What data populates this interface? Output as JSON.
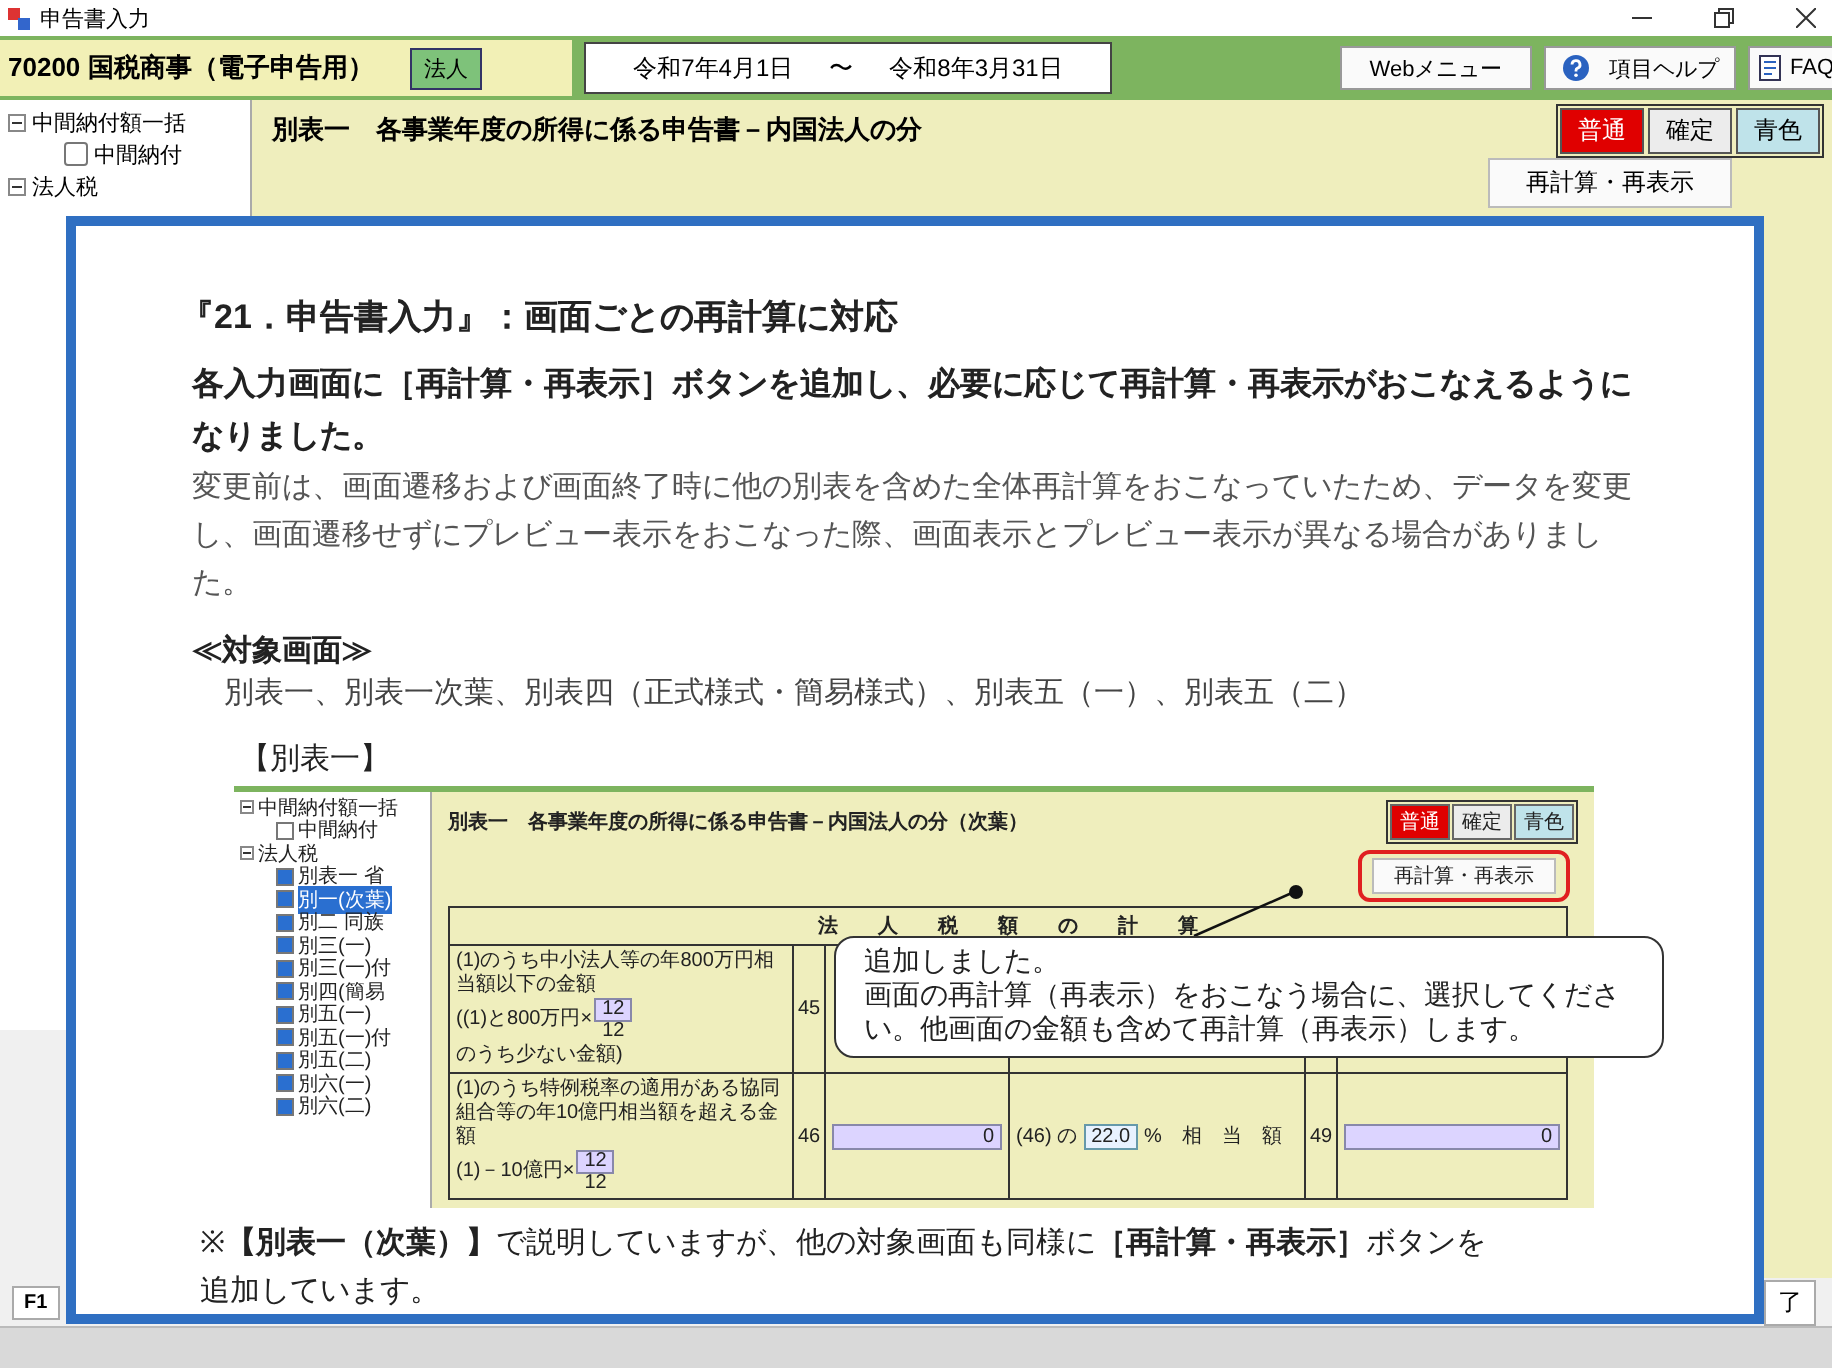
{
  "window": {
    "title": "申告書入力"
  },
  "header": {
    "company": "70200 国税商事（電子申告用）",
    "entity": "法人",
    "period_start": "令和7年4月1日",
    "period_sep": "〜",
    "period_end": "令和8年3月31日",
    "buttons": [
      {
        "label": "Webメニュー",
        "kind": "plain"
      },
      {
        "label": "項目ヘルプ",
        "kind": "help"
      },
      {
        "label": "FAQ",
        "kind": "faq"
      }
    ]
  },
  "tree": [
    {
      "label": "中間納付額一括",
      "expanded": true,
      "children": [
        {
          "label": "中間納付",
          "checked": false
        }
      ]
    },
    {
      "label": "法人税",
      "expanded": true
    }
  ],
  "form": {
    "title": "別表一　各事業年度の所得に係る申告書－内国法人の分",
    "modes": [
      {
        "label": "普通",
        "selected": true
      },
      {
        "label": "確定",
        "selected": false,
        "color": "#ececec"
      },
      {
        "label": "青色",
        "selected": false,
        "color": "#bfe3ea"
      }
    ],
    "recalc_button": "再計算・再表示"
  },
  "notice": {
    "heading": "『21．申告書入力』：画面ごとの再計算に対応",
    "lead": "各入力画面に［再計算・再表示］ボタンを追加し、必要に応じて再計算・再表示がおこなえるようになりました。",
    "body": "変更前は、画面遷移および画面終了時に他の別表を含めた全体再計算をおこなっていたため、データを変更し、画面遷移せずにプレビュー表示をおこなった際、画面表示とプレビュー表示が異なる場合がありました。",
    "section_title": "≪対象画面≫",
    "targets": "別表一、別表一次葉、別表四（正式様式・簡易様式）、別表五（一）、別表五（二）",
    "figure_label": "【別表一】",
    "figure": {
      "tree": [
        {
          "label": "中間納付額一括",
          "children": [
            {
              "label": "中間納付",
              "checked": false,
              "selected": false
            }
          ]
        },
        {
          "label": "法人税",
          "children": [
            {
              "label": "別表一 省",
              "checked": true,
              "selected": false
            },
            {
              "label": "別一(次葉)",
              "checked": true,
              "selected": true
            },
            {
              "label": "別二 同族",
              "checked": true,
              "selected": false
            },
            {
              "label": "別三(一)",
              "checked": true,
              "selected": false
            },
            {
              "label": "別三(一)付",
              "checked": true,
              "selected": false
            },
            {
              "label": "別四(簡易",
              "checked": true,
              "selected": false
            },
            {
              "label": "別五(一)",
              "checked": true,
              "selected": false
            },
            {
              "label": "別五(一)付",
              "checked": true,
              "selected": false
            },
            {
              "label": "別五(二)",
              "checked": true,
              "selected": false
            },
            {
              "label": "別六(一)",
              "checked": true,
              "selected": false
            },
            {
              "label": "別六(二)",
              "checked": true,
              "selected": false
            }
          ]
        }
      ],
      "title": "別表一　各事業年度の所得に係る申告書－内国法人の分（次葉）",
      "modes": [
        {
          "label": "普通",
          "selected": true
        },
        {
          "label": "確定",
          "selected": false,
          "color": "#ececec"
        },
        {
          "label": "青色",
          "selected": false,
          "color": "#bfe3ea"
        }
      ],
      "recalc_button": "再計算・再表示",
      "table_header": "法　　人　　税　　額　　の　　計　　算",
      "rows": [
        {
          "text": "(1)のうち中小法人等の年800万円相当額以下の金額",
          "formula_pre": "((1)と800万円×",
          "numerator": "12",
          "denominator": "12",
          "formula_post": "のうち少ない金額)",
          "line": "45"
        },
        {
          "text": "(1)のうち特例税率の適用がある協同組合等の年10億円相当額を超える金額",
          "formula_pre": "(1)－10億円×",
          "numerator": "12",
          "denominator": "12",
          "line": "46",
          "amount": "0",
          "rate_pre": "(46) の",
          "rate": "22.0",
          "rate_post": "%　相　当　額",
          "line2": "49",
          "amount2": "0"
        }
      ],
      "callout": [
        "追加しました。",
        "画面の再計算（再表示）をおこなう場合に、選択してください。他画面の金額も含めて再計算（再表示）します。"
      ]
    },
    "footnote": "※**【別表一（次葉）】**で説明していますが、他の対象画面も同様に**［再計算・再表示］**ボタンを追加しています。"
  },
  "function_keys": [
    {
      "label": "F1"
    }
  ],
  "end_button": "了"
}
